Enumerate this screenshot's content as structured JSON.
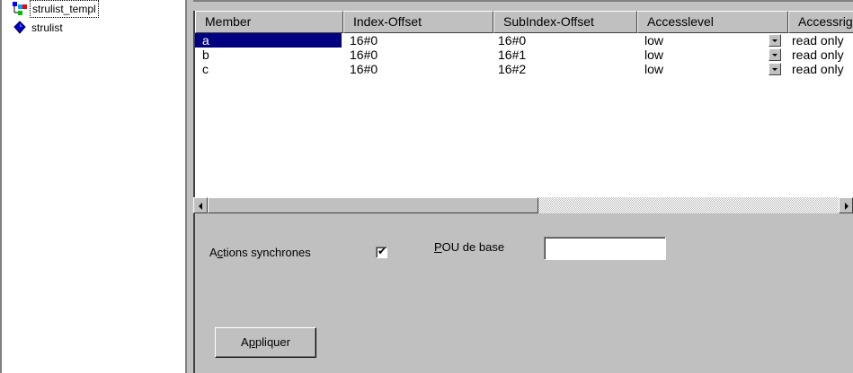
{
  "tree": {
    "items": [
      {
        "label": "strulist_templ",
        "icon": "template-icon"
      },
      {
        "label": "strulist",
        "icon": "diamond-icon"
      }
    ]
  },
  "grid": {
    "columns": [
      "Member",
      "Index-Offset",
      "SubIndex-Offset",
      "Accesslevel",
      "Accessright"
    ],
    "rows": [
      {
        "member": "a",
        "index_offset": "16#0",
        "subindex_offset": "16#0",
        "accesslevel": "low",
        "accessright": "read only"
      },
      {
        "member": "b",
        "index_offset": "16#0",
        "subindex_offset": "16#1",
        "accesslevel": "low",
        "accessright": "read only"
      },
      {
        "member": "c",
        "index_offset": "16#0",
        "subindex_offset": "16#2",
        "accesslevel": "low",
        "accessright": "read only"
      }
    ],
    "selected_row": 0
  },
  "form": {
    "sync_actions_prefix": "A",
    "sync_actions_accel": "c",
    "sync_actions_rest": "tions synchrones",
    "sync_actions_checked": true,
    "check_glyph": "✔",
    "base_pou_accel": "P",
    "base_pou_rest": "OU de base",
    "base_pou_value": "",
    "apply_prefix": "A",
    "apply_accel": "p",
    "apply_rest": "pliquer"
  },
  "colors": {
    "selection": "#000080",
    "face": "#c0c0c0"
  }
}
